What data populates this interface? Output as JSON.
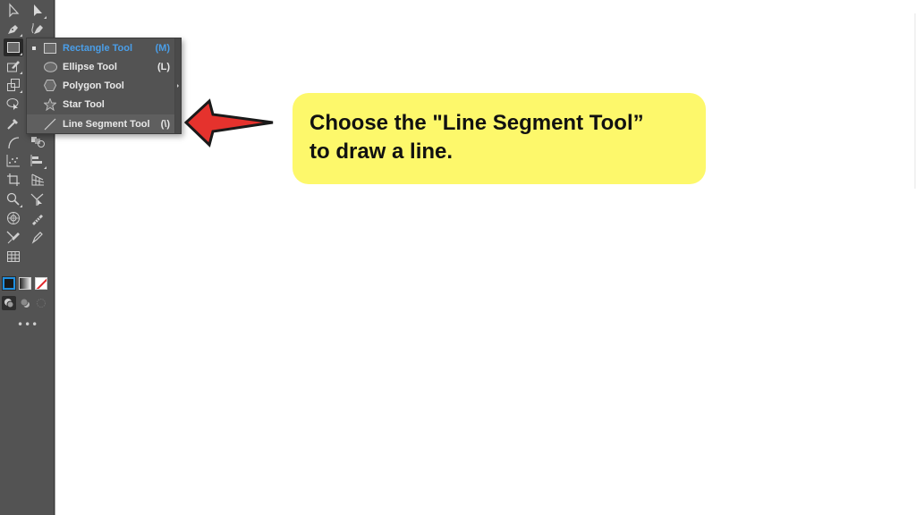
{
  "toolbar": {
    "tools": [
      {
        "name": "selection-tool",
        "icon": "selection-arrow-icon"
      },
      {
        "name": "direct-selection-tool",
        "icon": "direct-selection-arrow-icon"
      },
      {
        "name": "pen-tool",
        "icon": "pen-icon"
      },
      {
        "name": "curvature-tool",
        "icon": "curvature-pen-icon"
      },
      {
        "name": "rectangle-tool",
        "icon": "rectangle-icon",
        "active": true
      },
      {
        "name": "shaper-tool",
        "icon": "shaper-icon"
      },
      {
        "name": "scale-tool",
        "icon": "scale-icon"
      },
      {
        "name": "lasso-tool",
        "icon": "lasso-icon"
      },
      {
        "name": "eyedropper-tool",
        "icon": "eyedropper-icon"
      },
      {
        "name": "arc-tool",
        "icon": "arc-icon"
      },
      {
        "name": "blend-tool",
        "icon": "blend-icon"
      },
      {
        "name": "scatter-graph-tool",
        "icon": "scatter-graph-icon"
      },
      {
        "name": "bar-graph-tool",
        "icon": "bar-graph-icon"
      },
      {
        "name": "crop-tool",
        "icon": "crop-icon"
      },
      {
        "name": "perspective-grid-tool",
        "icon": "perspective-grid-icon"
      },
      {
        "name": "zoom-tool",
        "icon": "magnifier-icon"
      },
      {
        "name": "puppet-warp-tool",
        "icon": "puppet-warp-icon"
      },
      {
        "name": "symbol-sprayer-tool",
        "icon": "symbol-sprayer-icon"
      },
      {
        "name": "blob-brush-tool",
        "icon": "blob-brush-icon"
      },
      {
        "name": "knife-tool",
        "icon": "knife-icon"
      },
      {
        "name": "paintbrush-tool",
        "icon": "paintbrush-icon"
      },
      {
        "name": "mesh-tool",
        "icon": "grid-icon"
      }
    ],
    "more_label": "•••",
    "colors": {
      "stroke_accent": "#1f8fe0",
      "none_slash": "#e0262a"
    }
  },
  "flyout": {
    "items": [
      {
        "label": "Rectangle Tool",
        "shortcut": "(M)",
        "icon": "rectangle-icon",
        "current": true
      },
      {
        "label": "Ellipse Tool",
        "shortcut": "(L)",
        "icon": "ellipse-icon"
      },
      {
        "label": "Polygon Tool",
        "shortcut": "",
        "icon": "polygon-icon"
      },
      {
        "label": "Star Tool",
        "shortcut": "",
        "icon": "star-icon"
      },
      {
        "label": "Line Segment Tool",
        "shortcut": "(\\)",
        "icon": "line-segment-icon",
        "hovered": true
      }
    ],
    "current_color": "#4a9ee8"
  },
  "callout": {
    "line1": "Choose the \"Line Segment Tool”",
    "line2": "to draw a line.",
    "background": "#fdf86b",
    "arrow_color": "#e5322d"
  }
}
